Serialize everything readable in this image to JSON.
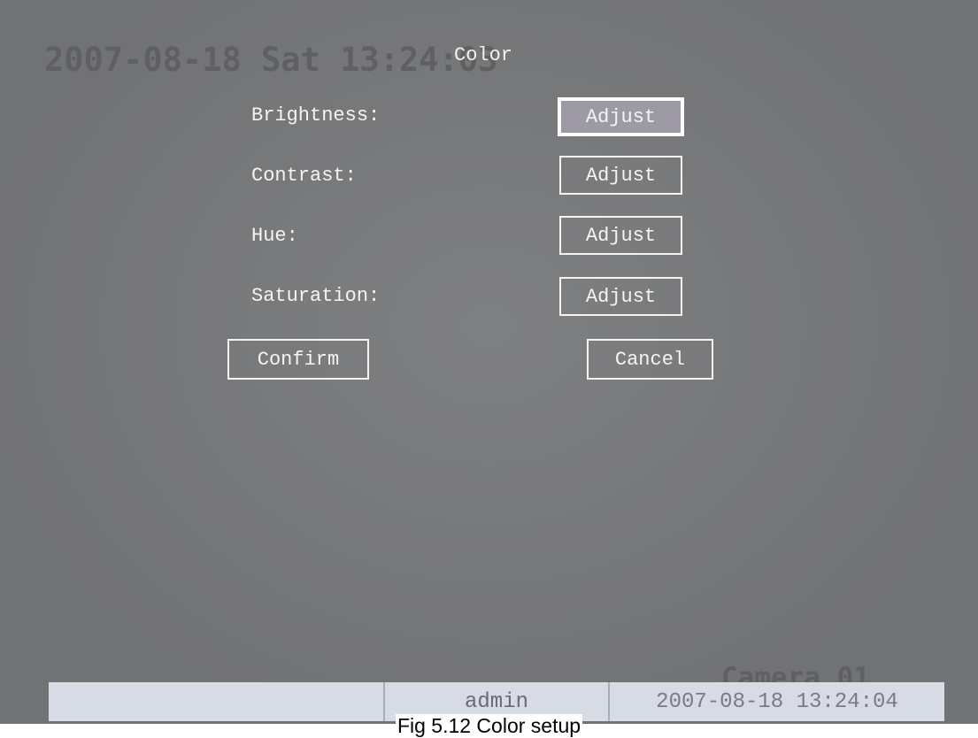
{
  "osd": {
    "datetime": "2007-08-18 Sat 13:24:03",
    "title": "Color",
    "camera": "Camera 01"
  },
  "menu": {
    "items": [
      {
        "label": "Brightness:",
        "button": "Adjust",
        "selected": true
      },
      {
        "label": "Contrast:",
        "button": "Adjust",
        "selected": false
      },
      {
        "label": "Hue:",
        "button": "Adjust",
        "selected": false
      },
      {
        "label": "Saturation:",
        "button": "Adjust",
        "selected": false
      }
    ],
    "confirm_label": "Confirm",
    "cancel_label": "Cancel"
  },
  "status_bar": {
    "left": "",
    "user": "admin",
    "datetime": "2007-08-18 13:24:04"
  },
  "caption": "Fig 5.12 Color setup"
}
